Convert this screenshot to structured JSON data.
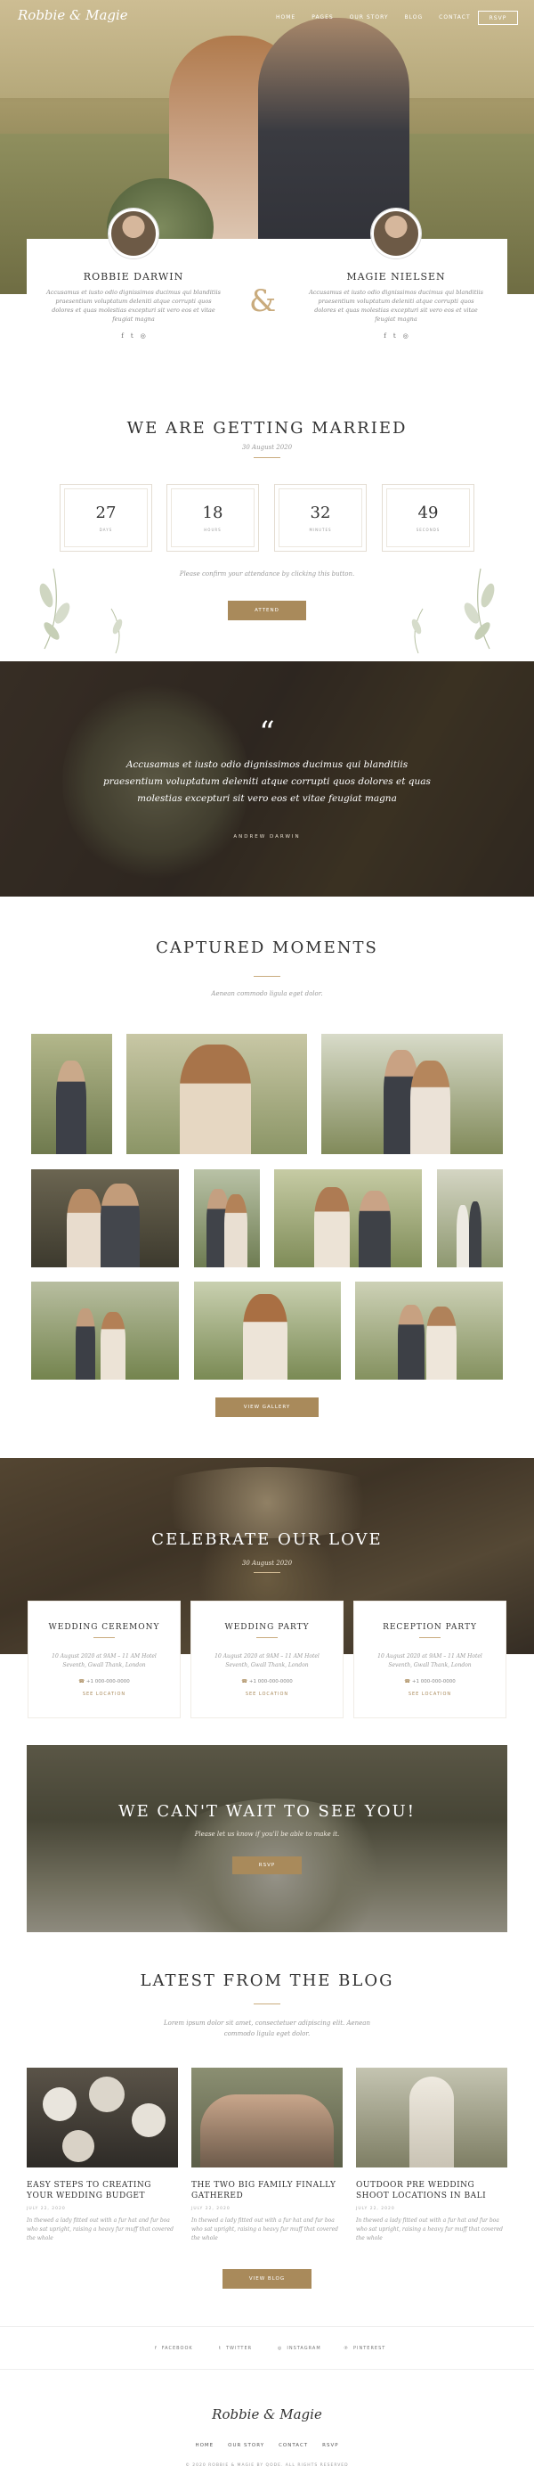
{
  "header": {
    "logo": "Robbie & Magie",
    "nav": [
      "HOME",
      "PAGES",
      "OUR STORY",
      "BLOG",
      "CONTACT"
    ],
    "rsvp_label": "RSVP"
  },
  "couple": {
    "groom": {
      "name": "ROBBIE DARWIN",
      "bio": "Accusamus et iusto odio dignissimos ducimus qui blanditiis praesentium voluptatum deleniti atque corrupti quos dolores et quas molestias excepturi sit vero eos et vitae feugiat magna"
    },
    "bride": {
      "name": "MAGIE NIELSEN",
      "bio": "Accusamus et iusto odio dignissimos ducimus qui blanditiis praesentium voluptatum deleniti atque corrupti quos dolores et quas molestias excepturi sit vero eos et vitae feugiat magna"
    },
    "ampersand": "&",
    "social_icons": [
      "facebook-icon",
      "twitter-icon",
      "instagram-icon"
    ]
  },
  "married": {
    "title": "WE ARE GETTING MARRIED",
    "date": "30 August 2020",
    "countdown": [
      {
        "value": "27",
        "label": "DAYS"
      },
      {
        "value": "18",
        "label": "HOURS"
      },
      {
        "value": "32",
        "label": "MINUTES"
      },
      {
        "value": "49",
        "label": "SECONDS"
      }
    ],
    "confirm_text": "Please confirm your attendance by clicking this button.",
    "attend_label": "ATTEND"
  },
  "quote": {
    "mark": "“",
    "text": "Accusamus et iusto odio dignissimos ducimus qui blanditiis praesentium voluptatum deleniti atque corrupti quos dolores et quas molestias excepturi sit vero eos et vitae feugiat magna",
    "author": "ANDREW DARWIN"
  },
  "gallery": {
    "title": "CAPTURED MOMENTS",
    "subtitle": "Aenean commodo ligula eget dolor.",
    "button_label": "VIEW GALLERY"
  },
  "celebrate": {
    "title": "CELEBRATE OUR LOVE",
    "date": "30 August 2020",
    "events": [
      {
        "title": "WEDDING CEREMONY",
        "when": "10 August 2020 at 9AM – 11 AM Hotel",
        "where": "Seventh, Gwall Thank, London",
        "phone": "+1 000-000-0000",
        "more": "SEE LOCATION"
      },
      {
        "title": "WEDDING PARTY",
        "when": "10 August 2020 at 9AM – 11 AM Hotel",
        "where": "Seventh, Gwall Thank, London",
        "phone": "+1 000-000-0000",
        "more": "SEE LOCATION"
      },
      {
        "title": "RECEPTION PARTY",
        "when": "10 August 2020 at 9AM – 11 AM Hotel",
        "where": "Seventh, Gwall Thank, London",
        "phone": "+1 000-000-0000",
        "more": "SEE LOCATION"
      }
    ]
  },
  "seeyou": {
    "title": "WE CAN'T WAIT TO SEE YOU!",
    "text": "Please let us know if you'll be able to make it.",
    "button_label": "RSVP"
  },
  "blog": {
    "title": "LATEST FROM THE BLOG",
    "subtitle": "Lorem ipsum dolor sit amet, consectetuer adipiscing elit. Aenean commodo ligula eget dolor.",
    "posts": [
      {
        "title": "EASY STEPS TO CREATING YOUR WEDDING BUDGET",
        "date": "JULY 22, 2020",
        "excerpt": "In thewed a lady fitted out with a fur hat and fur boa who sat upright, raising a heavy fur muff that covered the whole"
      },
      {
        "title": "THE TWO BIG FAMILY FINALLY GATHERED",
        "date": "JULY 22, 2020",
        "excerpt": "In thewed a lady fitted out with a fur hat and fur boa who sat upright, raising a heavy fur muff that covered the whole"
      },
      {
        "title": "OUTDOOR PRE WEDDING SHOOT LOCATIONS IN BALI",
        "date": "JULY 22, 2020",
        "excerpt": "In thewed a lady fitted out with a fur hat and fur boa who sat upright, raising a heavy fur muff that covered the whole"
      }
    ],
    "button_label": "VIEW BLOG"
  },
  "footer": {
    "social": [
      "FACEBOOK",
      "TWITTER",
      "INSTAGRAM",
      "PINTEREST"
    ],
    "logo": "Robbie & Magie",
    "nav": [
      "HOME",
      "OUR STORY",
      "CONTACT",
      "RSVP"
    ],
    "copyright": "© 2020 ROBBIE & MAGIE BY QODE. ALL RIGHTS RESERVED"
  },
  "colors": {
    "accent": "#a98a5b",
    "dark": "#333333"
  }
}
